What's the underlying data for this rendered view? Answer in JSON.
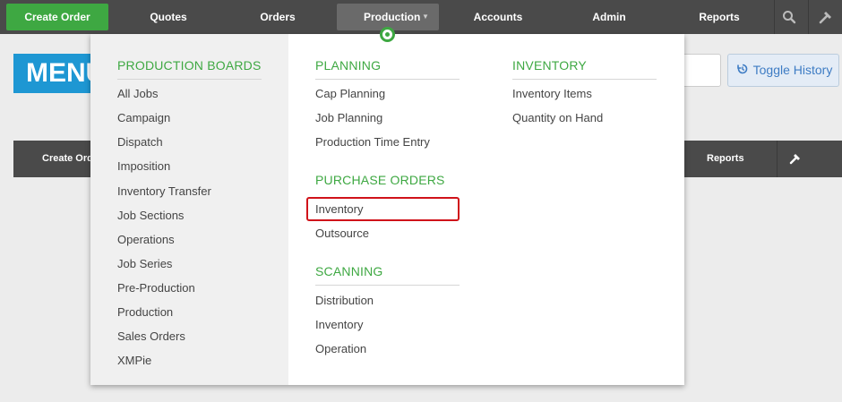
{
  "topnav": {
    "create_order": "Create Order",
    "quotes": "Quotes",
    "orders": "Orders",
    "production": "Production",
    "accounts": "Accounts",
    "admin": "Admin",
    "reports": "Reports"
  },
  "background": {
    "banner": "MENU",
    "toggle_history": "Toggle History",
    "second_nav": {
      "create_order": "Create Order",
      "reports": "Reports"
    }
  },
  "mega_menu": {
    "production_boards": {
      "heading": "PRODUCTION BOARDS",
      "items": [
        "All Jobs",
        "Campaign",
        "Dispatch",
        "Imposition",
        "Inventory Transfer",
        "Job Sections",
        "Operations",
        "Job Series",
        "Pre-Production",
        "Production",
        "Sales Orders",
        "XMPie"
      ]
    },
    "planning": {
      "heading": "PLANNING",
      "items": [
        "Cap Planning",
        "Job Planning",
        "Production Time Entry"
      ]
    },
    "purchase_orders": {
      "heading": "PURCHASE ORDERS",
      "items": [
        "Inventory",
        "Outsource"
      ]
    },
    "scanning": {
      "heading": "SCANNING",
      "items": [
        "Distribution",
        "Inventory",
        "Operation"
      ]
    },
    "inventory": {
      "heading": "INVENTORY",
      "items": [
        "Inventory Items",
        "Quantity on Hand"
      ]
    }
  },
  "colors": {
    "nav_bg": "#4a4a4a",
    "accent_green": "#3ea842",
    "banner_blue": "#1e97d3",
    "highlight_red": "#d0131a"
  }
}
